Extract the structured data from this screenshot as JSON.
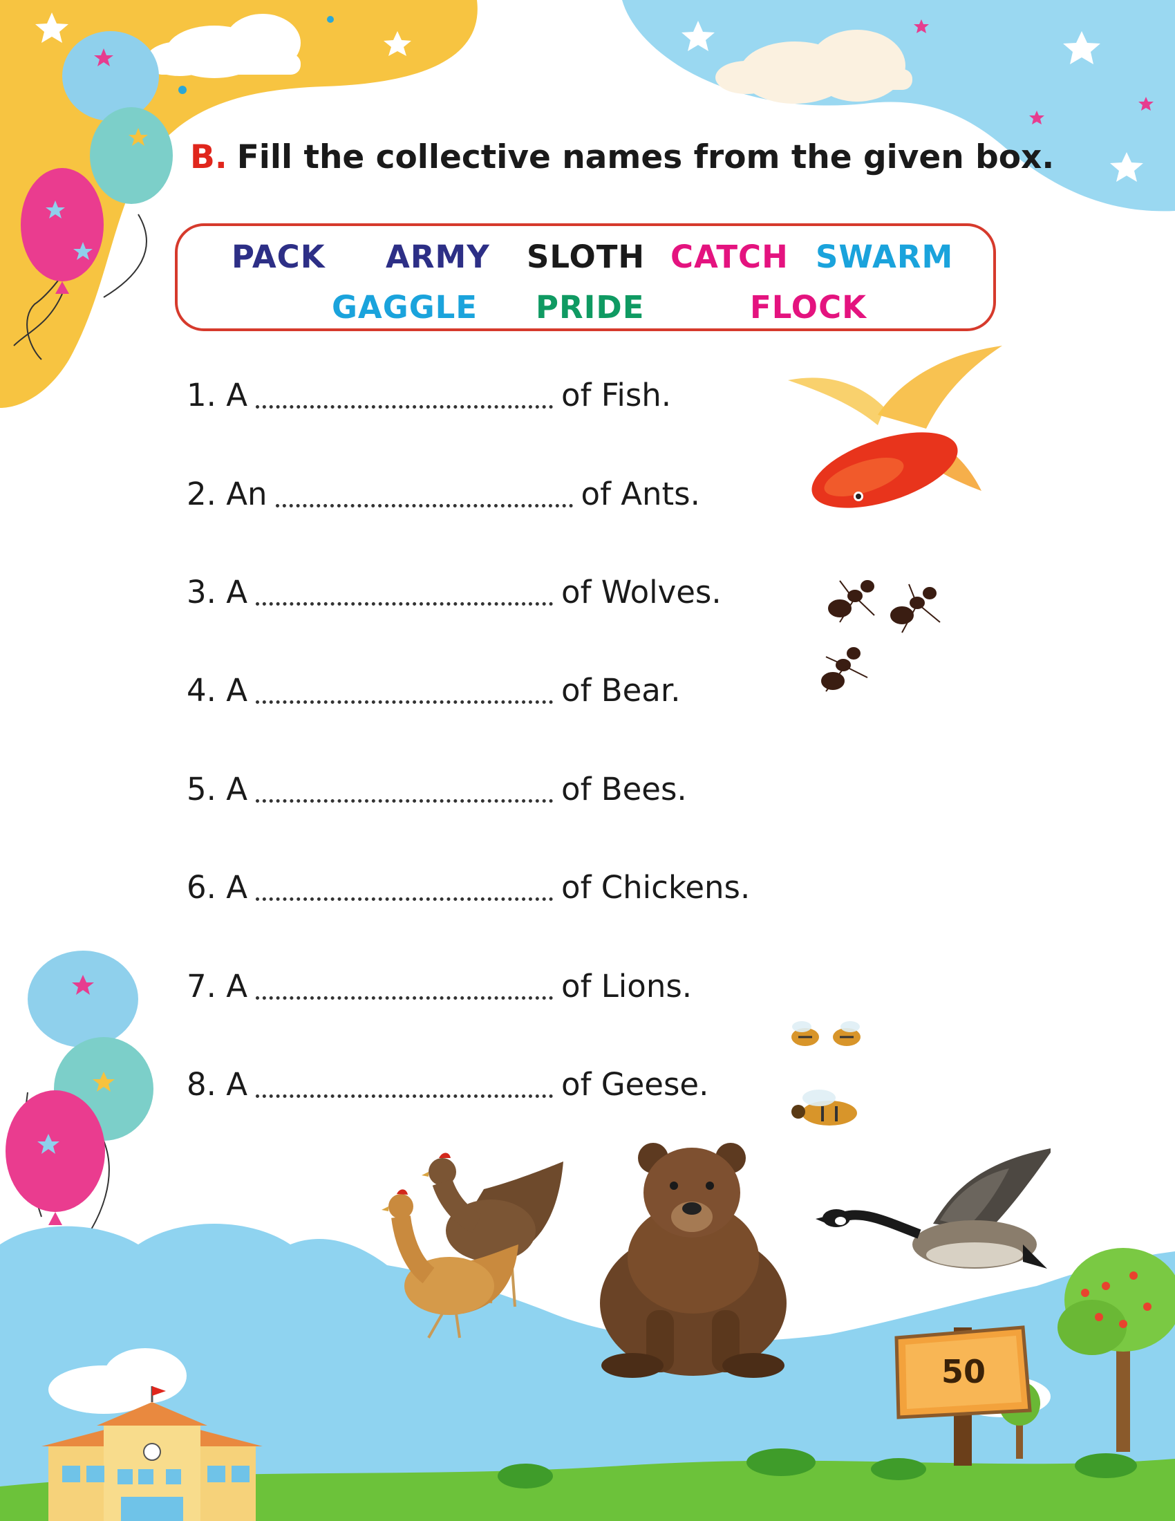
{
  "exercise": {
    "letter": "B.",
    "instruction": "Fill the collective names from the given box."
  },
  "word_box": [
    {
      "word": "PACK",
      "color": "#2d2f86"
    },
    {
      "word": "ARMY",
      "color": "#2d2f86"
    },
    {
      "word": "SLOTH",
      "color": "#1a1a1a"
    },
    {
      "word": "CATCH",
      "color": "#e4137f"
    },
    {
      "word": "SWARM",
      "color": "#1aa3dc"
    },
    {
      "word": "GAGGLE",
      "color": "#1aa3dc"
    },
    {
      "word": "PRIDE",
      "color": "#0f9a62"
    },
    {
      "word": "FLOCK",
      "color": "#e4137f"
    }
  ],
  "questions": [
    {
      "prefix": "1. A",
      "suffix": "of Fish."
    },
    {
      "prefix": "2. An",
      "suffix": "of Ants."
    },
    {
      "prefix": "3. A",
      "suffix": "of Wolves."
    },
    {
      "prefix": "4. A",
      "suffix": "of Bear."
    },
    {
      "prefix": "5. A",
      "suffix": "of Bees."
    },
    {
      "prefix": "6. A",
      "suffix": "of Chickens."
    },
    {
      "prefix": "7. A",
      "suffix": "of Lions."
    },
    {
      "prefix": "8. A",
      "suffix": "of Geese."
    }
  ],
  "page_number": "50",
  "colors": {
    "heading_letter": "#e0261c",
    "box_border": "#d63a2c",
    "sky": "#8fd3f0",
    "grass": "#6cc23a",
    "corner_yellow": "#f7c441"
  }
}
